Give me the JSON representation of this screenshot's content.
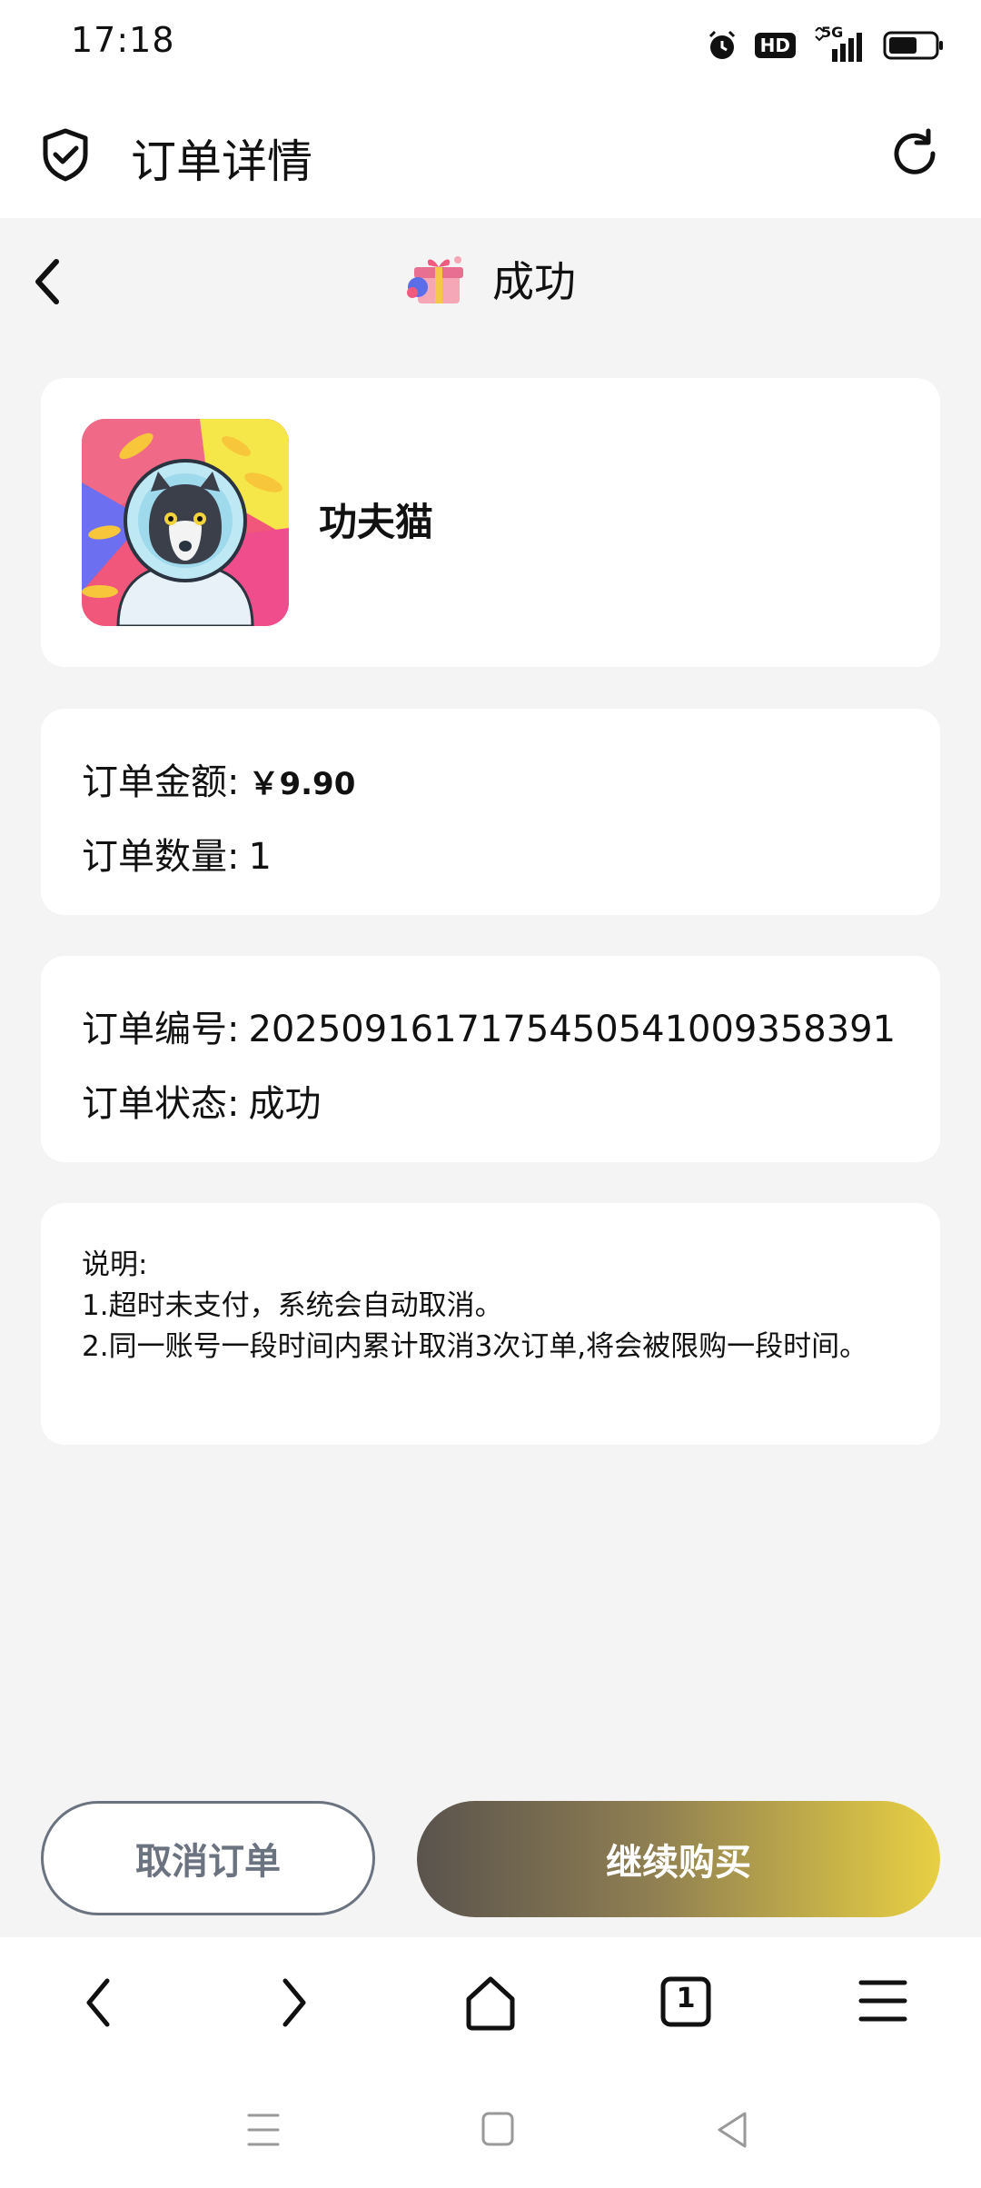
{
  "status_bar": {
    "time": "17:18",
    "hd_badge": "HD",
    "network_label": "5G"
  },
  "browser": {
    "title": "订单详情"
  },
  "page": {
    "title": "成功"
  },
  "product": {
    "name": "功夫猫"
  },
  "amounts": {
    "amount_label": "订单金额:",
    "amount_value": "￥9.90",
    "quantity_label": "订单数量:",
    "quantity_value": "1"
  },
  "order": {
    "number_label": "订单编号:",
    "number_value": "2025091617175450541009358391",
    "status_label": "订单状态:",
    "status_value": "成功"
  },
  "notes": {
    "title": "说明:",
    "line1": "1.超时未支付，系统会自动取消。",
    "line2": "2.同一账号一段时间内累计取消3次订单,将会被限购一段时间。"
  },
  "buttons": {
    "cancel": "取消订单",
    "continue": "继续购买"
  },
  "browser_nav": {
    "tab_count": "1"
  },
  "colors": {
    "background": "#f4f4f4",
    "accent_start": "#5a534d",
    "accent_end": "#e8d043",
    "outline": "#6b7280"
  }
}
